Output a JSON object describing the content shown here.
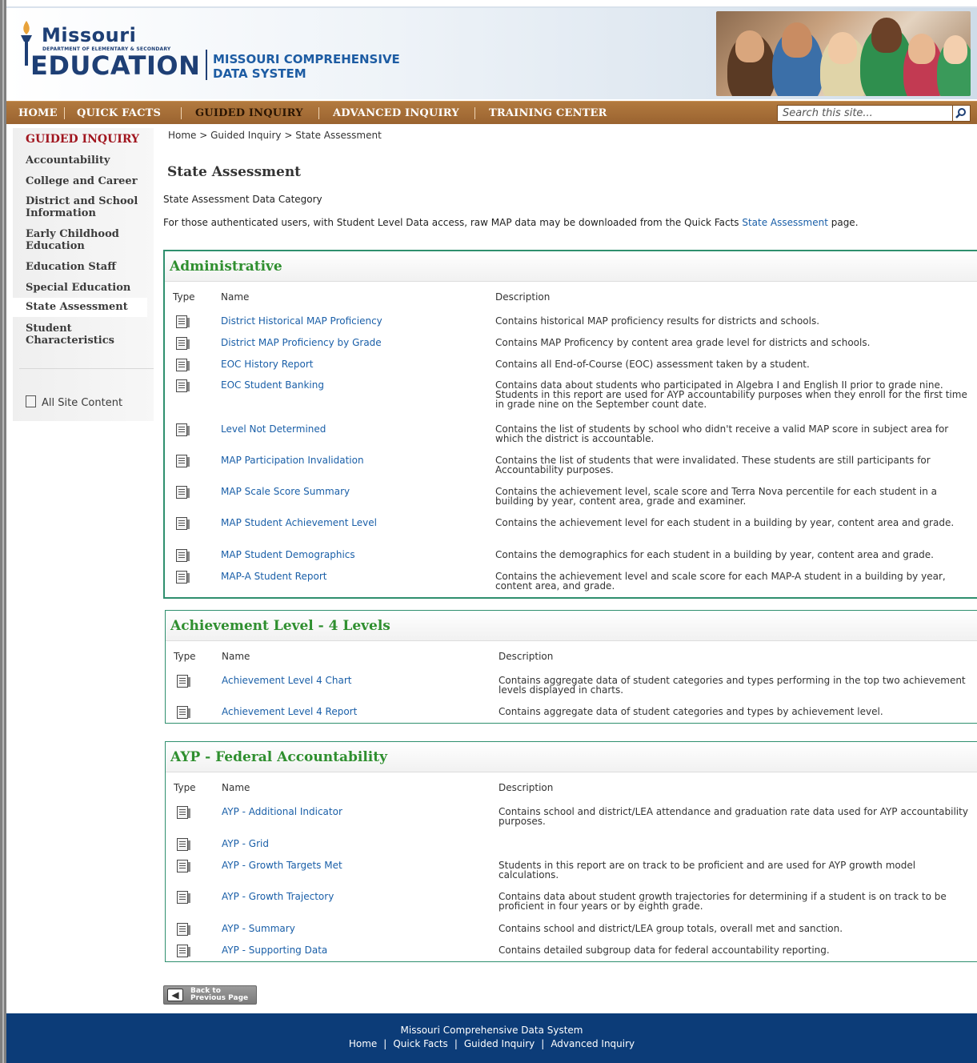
{
  "header": {
    "logo_top": "Missouri",
    "logo_dept": "Department of Elementary & Secondary",
    "logo_bottom": "EDUCATION",
    "system_line1": "MISSOURI COMPREHENSIVE",
    "system_line2": "DATA SYSTEM"
  },
  "nav": {
    "items": [
      "HOME",
      "QUICK FACTS",
      "GUIDED INQUIRY",
      "ADVANCED INQUIRY",
      "TRAINING CENTER"
    ],
    "active": "GUIDED INQUIRY",
    "search_placeholder": "Search this site..."
  },
  "sidebar": {
    "heading": "GUIDED INQUIRY",
    "items": [
      {
        "label": "Accountability"
      },
      {
        "label": "College and Career"
      },
      {
        "label": "District and School Information"
      },
      {
        "label": "Early Childhood Education"
      },
      {
        "label": "Education Staff"
      },
      {
        "label": "Special Education"
      },
      {
        "label": "State Assessment"
      },
      {
        "label": "Student Characteristics"
      }
    ],
    "current": "State Assessment",
    "all_content": "All Site Content"
  },
  "breadcrumb": "Home > Guided Inquiry > State Assessment",
  "page_title": "State Assessment",
  "category_label": "State Assessment Data Category",
  "note": {
    "before": "For those authenticated users, with Student Level Data access, raw MAP data may be downloaded from the Quick Facts ",
    "link": "State Assessment",
    "after": " page."
  },
  "columns": {
    "type": "Type",
    "name": "Name",
    "description": "Description"
  },
  "sections": [
    {
      "title": "Administrative",
      "rows": [
        {
          "name": "District Historical MAP Proficiency",
          "description": "Contains historical MAP proficiency results for districts and schools."
        },
        {
          "name": "District MAP Proficiency by Grade",
          "description": "Contains MAP Proficency by content area grade level for districts and schools."
        },
        {
          "name": "EOC History Report",
          "description": "Contains all End-of-Course (EOC) assessment taken by a student."
        },
        {
          "name": "EOC Student Banking",
          "description": "Contains data about students who participated in Algebra I and English II prior to grade nine.  Students in this report are used for AYP accountability purposes when they enroll for the first time in grade nine on the September count date."
        },
        {
          "name": "Level Not Determined",
          "description": "Contains the list of students by school who didn't receive a valid MAP score in subject area for which the district is accountable."
        },
        {
          "name": "MAP Participation Invalidation",
          "description": "Contains the list of students that were invalidated. These students are still participants for Accountability purposes."
        },
        {
          "name": "MAP Scale Score Summary",
          "description": "Contains the achievement level, scale score and Terra Nova percentile for each student in a building by year, content area, grade and examiner."
        },
        {
          "name": "MAP Student Achievement Level",
          "description": "Contains the achievement level for each student in a building by year, content area and grade."
        },
        {
          "name": "MAP Student Demographics",
          "description": "Contains the demographics for each student in a building by year, content area and grade."
        },
        {
          "name": "MAP-A Student Report",
          "description": "Contains the achievement level and scale score for each MAP-A student in a building by year, content area, and grade."
        }
      ]
    },
    {
      "title": "Achievement Level - 4 Levels",
      "rows": [
        {
          "name": "Achievement Level 4 Chart",
          "description": "Contains aggregate data of student categories and types performing in the top two achievement levels displayed in charts."
        },
        {
          "name": "Achievement Level 4 Report",
          "description": "Contains aggregate data of student categories and types by achievement level."
        }
      ]
    },
    {
      "title": "AYP - Federal Accountability",
      "rows": [
        {
          "name": "AYP - Additional Indicator",
          "description": "Contains school and district/LEA attendance and graduation rate data used for AYP accountability purposes."
        },
        {
          "name": "AYP - Grid",
          "description": ""
        },
        {
          "name": "AYP - Growth Targets Met",
          "description": "Students in this report are on track to be proficient and are used for AYP growth model calculations."
        },
        {
          "name": "AYP - Growth Trajectory",
          "description": "Contains data about student growth trajectories for determining if a student is on track to be proficient in four years or by eighth grade."
        },
        {
          "name": "AYP - Summary",
          "description": "Contains school and district/LEA group totals, overall met and sanction."
        },
        {
          "name": "AYP - Supporting Data",
          "description": "Contains detailed subgroup data for federal accountability reporting."
        }
      ]
    }
  ],
  "back_button": {
    "line1": "Back to",
    "line2": "Previous Page"
  },
  "footer": {
    "title": "Missouri Comprehensive Data System",
    "links": [
      "Home",
      "Quick Facts",
      "Guided Inquiry",
      "Advanced Inquiry"
    ]
  },
  "colors": {
    "nav": "#a86f38",
    "section_title": "#2f8f2f",
    "panel_border": "#2f8f6e",
    "sidebar_heading": "#a1161f",
    "footer": "#0c3c78",
    "link": "#1a5fa8"
  }
}
